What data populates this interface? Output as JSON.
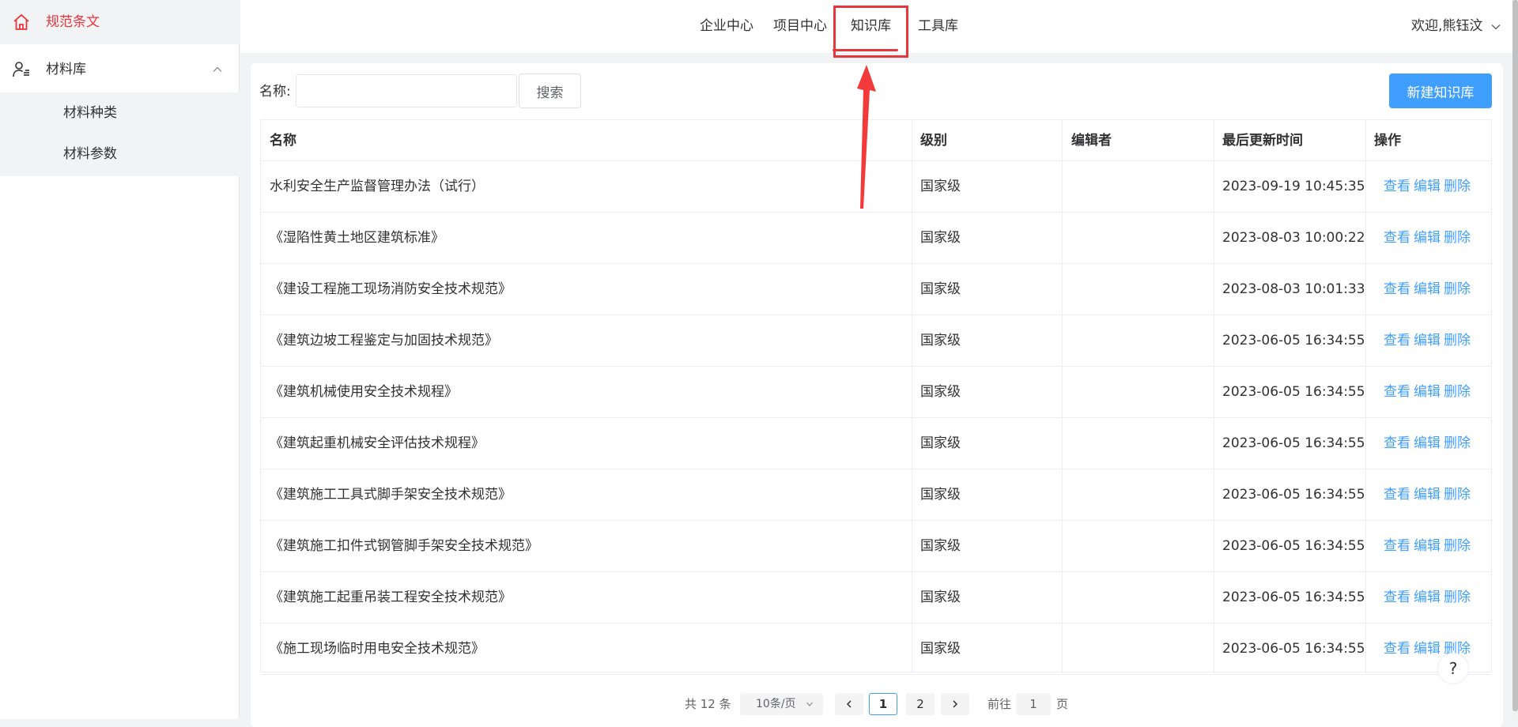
{
  "sidebar": {
    "active_item": {
      "label": "规范条文",
      "icon": "home-icon"
    },
    "group": {
      "label": "材料库",
      "icon": "user-list-icon",
      "expanded": true
    },
    "sub_items": [
      {
        "label": "材料种类"
      },
      {
        "label": "材料参数"
      }
    ]
  },
  "header": {
    "tabs": [
      {
        "label": "企业中心"
      },
      {
        "label": "项目中心"
      },
      {
        "label": "知识库",
        "active": true
      },
      {
        "label": "工具库"
      }
    ],
    "user_greeting": "欢迎,熊钰汶"
  },
  "search": {
    "label": "名称:",
    "value": "",
    "placeholder": "",
    "button_label": "搜索"
  },
  "new_button_label": "新建知识库",
  "table": {
    "headers": [
      "名称",
      "级别",
      "编辑者",
      "最后更新时间",
      "操作"
    ],
    "actions": [
      "查看",
      "编辑",
      "删除"
    ],
    "rows": [
      {
        "name": "水利安全生产监督管理办法（试行）",
        "level": "国家级",
        "editor": "",
        "updated": "2023-09-19 10:45:35"
      },
      {
        "name": "《湿陷性黄土地区建筑标准》",
        "level": "国家级",
        "editor": "",
        "updated": "2023-08-03 10:00:22"
      },
      {
        "name": "《建设工程施工现场消防安全技术规范》",
        "level": "国家级",
        "editor": "",
        "updated": "2023-08-03 10:01:33"
      },
      {
        "name": "《建筑边坡工程鉴定与加固技术规范》",
        "level": "国家级",
        "editor": "",
        "updated": "2023-06-05 16:34:55"
      },
      {
        "name": "《建筑机械使用安全技术规程》",
        "level": "国家级",
        "editor": "",
        "updated": "2023-06-05 16:34:55"
      },
      {
        "name": "《建筑起重机械安全评估技术规程》",
        "level": "国家级",
        "editor": "",
        "updated": "2023-06-05 16:34:55"
      },
      {
        "name": "《建筑施工工具式脚手架安全技术规范》",
        "level": "国家级",
        "editor": "",
        "updated": "2023-06-05 16:34:55"
      },
      {
        "name": "《建筑施工扣件式钢管脚手架安全技术规范》",
        "level": "国家级",
        "editor": "",
        "updated": "2023-06-05 16:34:55"
      },
      {
        "name": "《建筑施工起重吊装工程安全技术规范》",
        "level": "国家级",
        "editor": "",
        "updated": "2023-06-05 16:34:55"
      },
      {
        "name": "《施工现场临时用电安全技术规范》",
        "level": "国家级",
        "editor": "",
        "updated": "2023-06-05 16:34:55"
      }
    ]
  },
  "pagination": {
    "total_text": "共 12 条",
    "page_size": "10条/页",
    "pages": [
      "1",
      "2"
    ],
    "current_page": "1",
    "goto_label": "前往",
    "goto_value": "1",
    "goto_suffix": "页"
  },
  "help_label": "?",
  "colors": {
    "accent_red": "#e8363c",
    "primary_blue": "#409eff",
    "link_blue": "#409eff"
  }
}
